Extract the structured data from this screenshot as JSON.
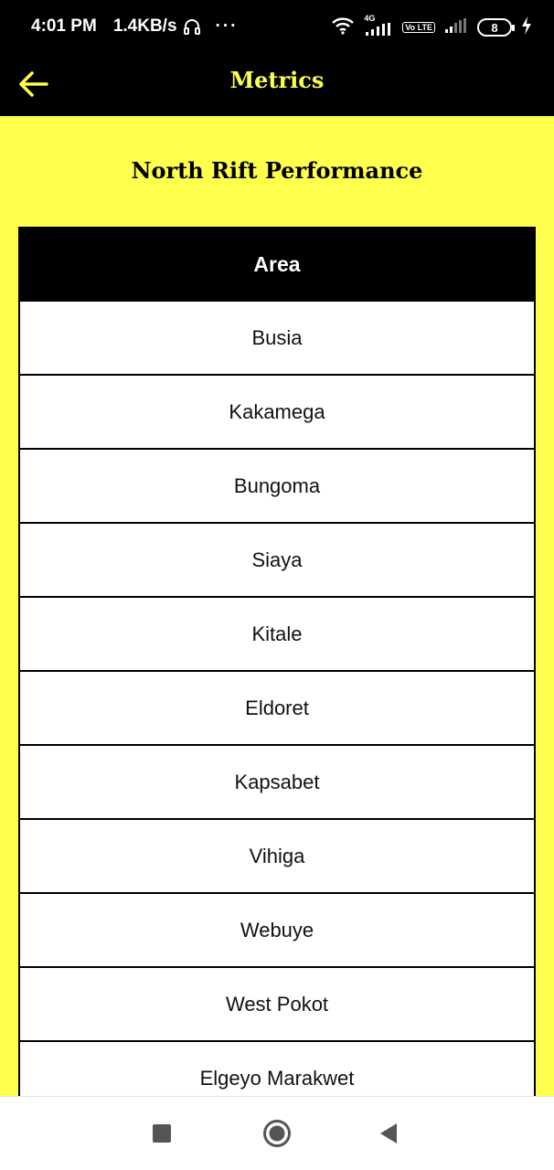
{
  "status": {
    "time": "4:01 PM",
    "speed": "1.4KB/s",
    "dots": "···",
    "network_4g": "4G",
    "volte": "Vo LTE",
    "battery": "8"
  },
  "app_bar": {
    "title": "Metrics",
    "accent_color": "#ffff4d",
    "back_icon": "arrow-left-icon"
  },
  "page": {
    "heading": "North Rift Performance"
  },
  "table": {
    "header": "Area",
    "rows": [
      "Busia",
      "Kakamega",
      "Bungoma",
      "Siaya",
      "Kitale",
      "Eldoret",
      "Kapsabet",
      "Vihiga",
      "Webuye",
      "West Pokot",
      "Elgeyo Marakwet"
    ]
  },
  "nav": {
    "icons": [
      "square-icon",
      "circle-home-icon",
      "triangle-back-icon"
    ]
  }
}
